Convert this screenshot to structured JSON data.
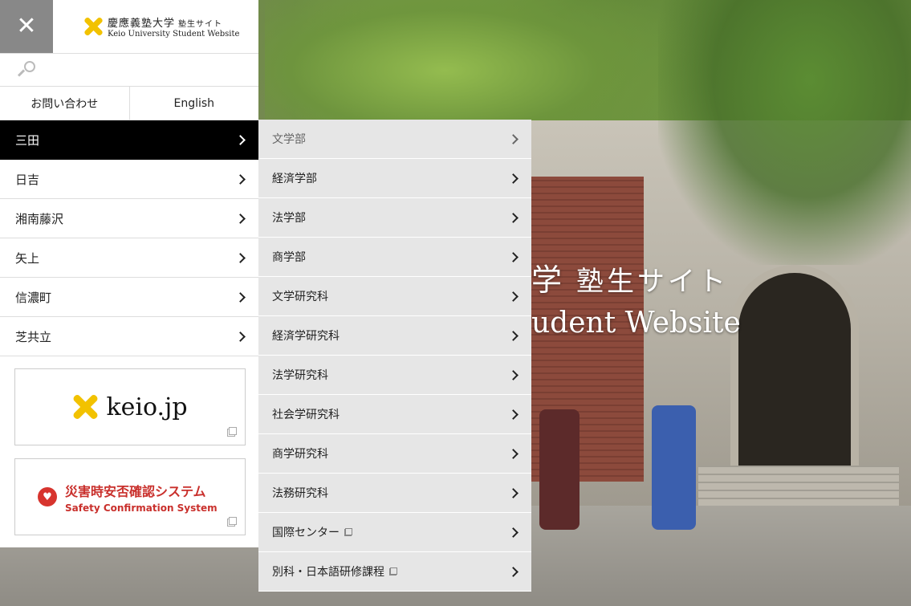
{
  "header": {
    "close_icon": "close-icon",
    "logo_jp": "慶應義塾大学",
    "logo_jp_sub": "塾生サイト",
    "logo_en": "Keio University Student Website"
  },
  "search": {
    "icon": "search-icon"
  },
  "links": {
    "contact": "お問い合わせ",
    "english": "English"
  },
  "campuses": [
    {
      "label": "三田",
      "active": true
    },
    {
      "label": "日吉"
    },
    {
      "label": "湘南藤沢"
    },
    {
      "label": "矢上"
    },
    {
      "label": "信濃町"
    },
    {
      "label": "芝共立"
    }
  ],
  "banners": {
    "keio": {
      "text": "keio.jp"
    },
    "safety": {
      "jp": "災害時安否確認システム",
      "en": "Safety Confirmation System"
    }
  },
  "submenu": [
    {
      "label": "文学部"
    },
    {
      "label": "経済学部"
    },
    {
      "label": "法学部"
    },
    {
      "label": "商学部"
    },
    {
      "label": "文学研究科"
    },
    {
      "label": "経済学研究科"
    },
    {
      "label": "法学研究科"
    },
    {
      "label": "社会学研究科"
    },
    {
      "label": "商学研究科"
    },
    {
      "label": "法務研究科"
    },
    {
      "label": "国際センター",
      "external": true
    },
    {
      "label": "別科・日本語研修課程",
      "external": true
    }
  ],
  "hero": {
    "jp_main": "学",
    "jp_sub": "塾生サイト",
    "en": "udent Website"
  },
  "colors": {
    "accent": "#f2c200",
    "active_bg": "#000000",
    "safety_red": "#c9302c",
    "submenu_bg": "#e6e6e6"
  }
}
